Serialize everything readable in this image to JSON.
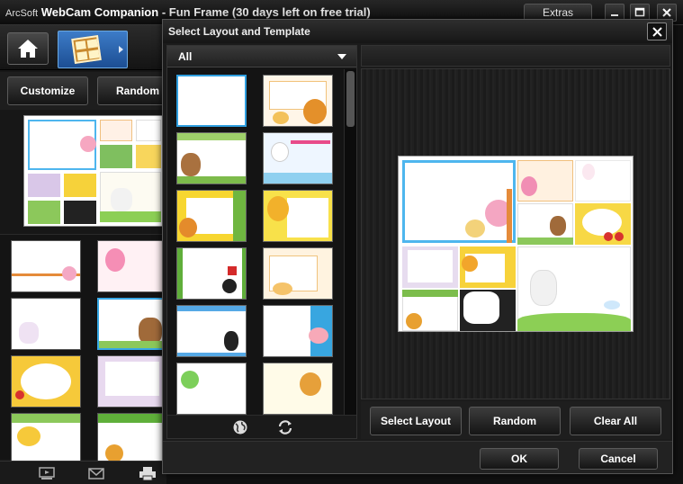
{
  "app": {
    "brand": "ArcSoft",
    "product": "WebCam Companion",
    "subtitle": "- Fun Frame (30 days left on free trial)",
    "extras_label": "Extras"
  },
  "left_panel": {
    "customize_label": "Customize",
    "random_label": "Random"
  },
  "dialog": {
    "title": "Select Layout and Template",
    "filter_value": "All",
    "select_layout_label": "Select Layout",
    "random_label": "Random",
    "clear_all_label": "Clear All",
    "ok_label": "OK",
    "cancel_label": "Cancel"
  },
  "colors": {
    "selection": "#2f9fe0",
    "frame_blue": "#3d7cc8"
  },
  "icons": [
    "home-icon",
    "fun-frame-icon",
    "minimize-icon",
    "maximize-icon",
    "close-icon",
    "globe-icon",
    "refresh-icon",
    "video-icon",
    "email-icon",
    "print-icon"
  ]
}
